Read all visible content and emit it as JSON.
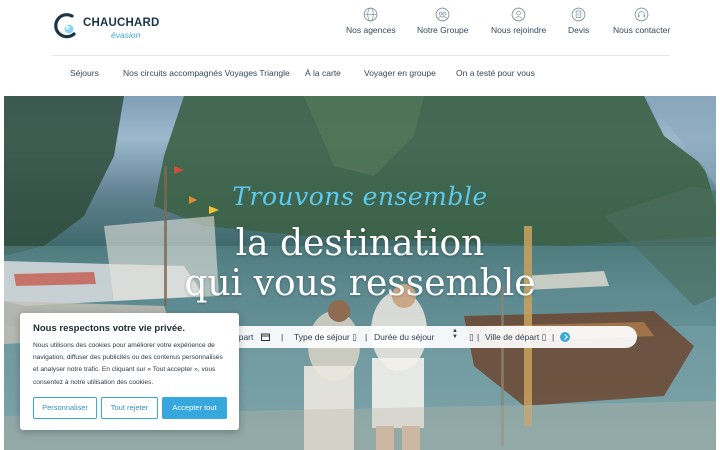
{
  "brand": {
    "name": "CHAUCHARD",
    "sub": "évasion",
    "accent_color": "#3aa8d8",
    "dark_color": "#1c3447"
  },
  "top_nav": [
    {
      "label": "Nos agences",
      "icon": "globe-icon"
    },
    {
      "label": "Notre Groupe",
      "icon": "group-icon"
    },
    {
      "label": "Nous rejoindre",
      "icon": "user-icon"
    },
    {
      "label": "Devis",
      "icon": "document-icon"
    },
    {
      "label": "Nous contacter",
      "icon": "headset-icon"
    }
  ],
  "main_nav": [
    "Séjours",
    "Nos circuits accompagnés Voyages Triangle",
    "À la carte",
    "Voyager en groupe",
    "On a testé pour vous"
  ],
  "hero": {
    "tagline": "Trouvons ensemble",
    "headline_line1": "la destination",
    "headline_line2": "qui vous ressemble",
    "tagline_color": "#5cc9ef"
  },
  "search": {
    "date_partial": "épart",
    "date_icon": "calendar-icon",
    "type_label": "Type de séjour",
    "type_caret": "▯",
    "duration_label": "Durée du séjour",
    "duration_caret": "▯",
    "city_label": "Ville de départ",
    "city_caret": "▯",
    "separator": "|",
    "go_icon": "arrow-right-icon"
  },
  "cookie": {
    "title": "Nous respectons votre vie privée.",
    "text": "Nous utilisons des cookies pour améliorer votre expérience de navigation, diffuser des publicités ou des contenus personnalisés et analyser notre trafic. En cliquant sur « Tout accepter », vous consentez à notre utilisation des cookies.",
    "btn_customize": "Personnaliser",
    "btn_reject": "Tout rejeter",
    "btn_accept": "Accepter tout"
  }
}
